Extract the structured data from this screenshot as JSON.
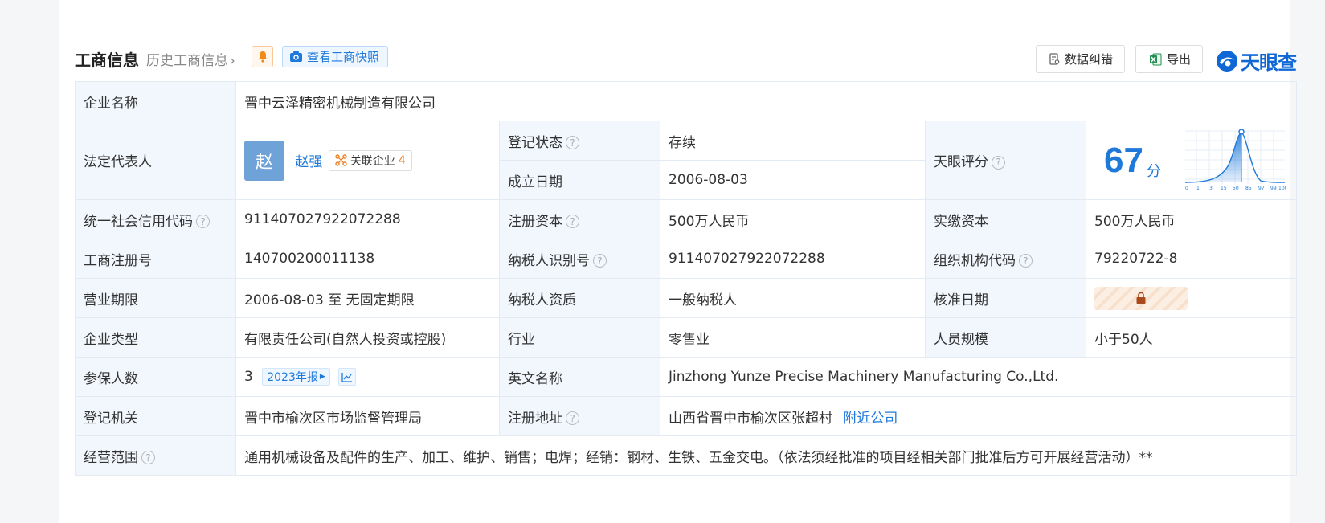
{
  "header": {
    "title": "工商信息",
    "history_link": "历史工商信息",
    "snapshot_btn": "查看工商快照",
    "correct_btn": "数据纠错",
    "export_btn": "导出",
    "logo_text": "天眼查"
  },
  "colors": {
    "accent": "#1f79db",
    "label_bg": "#f2f7fd",
    "status_green": "#1aa64a",
    "related_orange": "#ef7d22"
  },
  "rows": {
    "company_name": {
      "label": "企业名称",
      "value": "晋中云泽精密机械制造有限公司"
    },
    "legal_rep": {
      "label": "法定代表人",
      "avatar": "赵",
      "name": "赵强",
      "related_label": "关联企业",
      "related_count": "4"
    },
    "status": {
      "label": "登记状态",
      "value": "存续"
    },
    "found_date": {
      "label": "成立日期",
      "value": "2006-08-03"
    },
    "score": {
      "label": "天眼评分",
      "value": "67",
      "unit": "分",
      "ticks": [
        "0",
        "1",
        "3",
        "15",
        "50",
        "85",
        "97",
        "99",
        "100"
      ]
    },
    "credit_code": {
      "label": "统一社会信用代码",
      "value": "911407027922072288"
    },
    "reg_capital": {
      "label": "注册资本",
      "value": "500万人民币"
    },
    "paid_capital": {
      "label": "实缴资本",
      "value": "500万人民币"
    },
    "reg_no": {
      "label": "工商注册号",
      "value": "140700200011138"
    },
    "taxpayer_id": {
      "label": "纳税人识别号",
      "value": "911407027922072288"
    },
    "org_code": {
      "label": "组织机构代码",
      "value": "79220722-8"
    },
    "term": {
      "label": "营业期限",
      "value": "2006-08-03 至 无固定期限"
    },
    "taxpayer_qual": {
      "label": "纳税人资质",
      "value": "一般纳税人"
    },
    "approve_date": {
      "label": "核准日期"
    },
    "company_type": {
      "label": "企业类型",
      "value": "有限责任公司(自然人投资或控股)"
    },
    "industry": {
      "label": "行业",
      "value": "零售业"
    },
    "staff_size": {
      "label": "人员规模",
      "value": "小于50人"
    },
    "insured": {
      "label": "参保人数",
      "value": "3",
      "report_tag": "2023年报"
    },
    "english_name": {
      "label": "英文名称",
      "value": "Jinzhong Yunze Precise Machinery Manufacturing Co.,Ltd."
    },
    "authority": {
      "label": "登记机关",
      "value": "晋中市榆次区市场监督管理局"
    },
    "address": {
      "label": "注册地址",
      "value": "山西省晋中市榆次区张超村",
      "nearby": "附近公司"
    },
    "scope": {
      "label": "经营范围",
      "value": "通用机械设备及配件的生产、加工、维护、销售；电焊；经销：钢材、生铁、五金交电。（依法须经批准的项目经相关部门批准后方可开展经营活动）**"
    }
  }
}
